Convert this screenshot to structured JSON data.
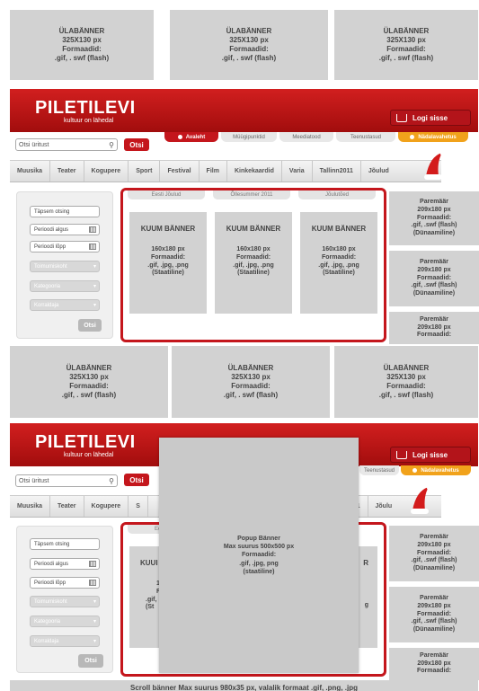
{
  "top_banners": [
    {
      "title": "ÜLABÄNNER",
      "size": "325X130 px",
      "formats_label": "Formaadid:",
      "formats": ".gif, . swf (flash)"
    },
    {
      "title": "ÜLABÄNNER",
      "size": "325X130 px",
      "formats_label": "Formaadid:",
      "formats": ".gif, . swf (flash)"
    },
    {
      "title": "ÜLABÄNNER",
      "size": "325X130 px",
      "formats_label": "Formaadid:",
      "formats": ".gif, . swf (flash)"
    }
  ],
  "header": {
    "logo": "PILETILEVI",
    "tagline": "kultuur on lähedal",
    "login": "Logi sisse",
    "colors": {
      "brand_red": "#c4161c",
      "accent_orange": "#f1a21b"
    }
  },
  "search": {
    "placeholder": "Otsi üritust",
    "button": "Otsi"
  },
  "tabs": [
    "Avaleht",
    "Müügipunktid",
    "Meediatood",
    "Teenustasud",
    "Nädalavahetus"
  ],
  "nav": [
    "Muusika",
    "Teater",
    "Kogupere",
    "Sport",
    "Festival",
    "Film",
    "Kinkekaardid",
    "Varia",
    "Tallinn2011",
    "Jõulud"
  ],
  "nav2": [
    "Muusika",
    "Teater",
    "Kogupere",
    "S",
    "linn2011",
    "Jõulu"
  ],
  "side_search": {
    "exact_search": "Täpsem otsing",
    "period_start": "Perioodi algus",
    "period_end": "Perioodi lõpp",
    "location": "Toimumiskoht",
    "category": "Kategooria",
    "performer": "Korraldaja",
    "button": "Otsi"
  },
  "hot": {
    "tabs": [
      "Eesti Jõulud",
      "Õllesummer 2011",
      "Jõulutõed"
    ],
    "banners": [
      {
        "title": "KUUM BÄNNER",
        "size": "160x180 px",
        "formats_label": "Formaadid:",
        "formats": ".gif, .jpg, .png",
        "type": "(Staatiline)"
      },
      {
        "title": "KUUM BÄNNER",
        "size": "160x180 px",
        "formats_label": "Formaadid:",
        "formats": ".gif, .jpg, .png",
        "type": "(Staatiline)"
      },
      {
        "title": "KUUM BÄNNER",
        "size": "160x180 px",
        "formats_label": "Formaadid:",
        "formats": ".gif, .jpg, .png",
        "type": "(Staatiline)"
      }
    ]
  },
  "right_banners": [
    {
      "title": "Paremäär",
      "size": "209x180 px",
      "formats_label": "Formaadid:",
      "formats": ".gif, .swf (flash)",
      "type": "(Dünaamiline)"
    },
    {
      "title": "Paremäär",
      "size": "209x180 px",
      "formats_label": "Formaadid:",
      "formats": ".gif, .swf (flash)",
      "type": "(Dünaamiline)"
    },
    {
      "title": "Paremäär",
      "size": "209x180 px",
      "formats_label": "Formaadid:"
    }
  ],
  "right_banners2": [
    {
      "title": "Paremäär",
      "size": "209x180 px",
      "formats_label": "Formaadid:",
      "formats": ".gif, .swf (flash)",
      "type": "(Dünaamiline)"
    },
    {
      "title": "Paremäär",
      "size": "209x180 px",
      "formats_label": "Formaadid:",
      "formats": ".gif, .swf (flash)",
      "type": "(Dünaamiline)"
    },
    {
      "title": "Paremäär",
      "size": "209x180 px",
      "formats_label": "Formaadid:"
    }
  ],
  "mid_banners": [
    {
      "title": "ÜLABÄNNER",
      "size": "325X130 px",
      "formats_label": "Formaadid:",
      "formats": ".gif, . swf (flash)"
    },
    {
      "title": "ÜLABÄNNER",
      "size": "325X130 px",
      "formats_label": "Formaadid:",
      "formats": ".gif, . swf (flash)"
    },
    {
      "title": "ÜLABÄNNER",
      "size": "325X130 px",
      "formats_label": "Formaadid:",
      "formats": ".gif, . swf (flash)"
    }
  ],
  "popup": {
    "title": "Popup Bänner",
    "size": "Max suurus 500x500 px",
    "formats_label": "Formaadid:",
    "formats": ".gif, .jpg, png",
    "type": "(staatiline)"
  },
  "hot2_partial": {
    "tab": "Ee",
    "left_title": "KUUI",
    "left_l1": "16",
    "left_l2": "Fo",
    "left_l3": ".gif,",
    "left_l4": "(St",
    "right_r": "R",
    "right_g": "g"
  },
  "scroll_banner": "Scroll bänner Max suurus 980x35 px, valalik formaat .gif, .png, .jpg"
}
